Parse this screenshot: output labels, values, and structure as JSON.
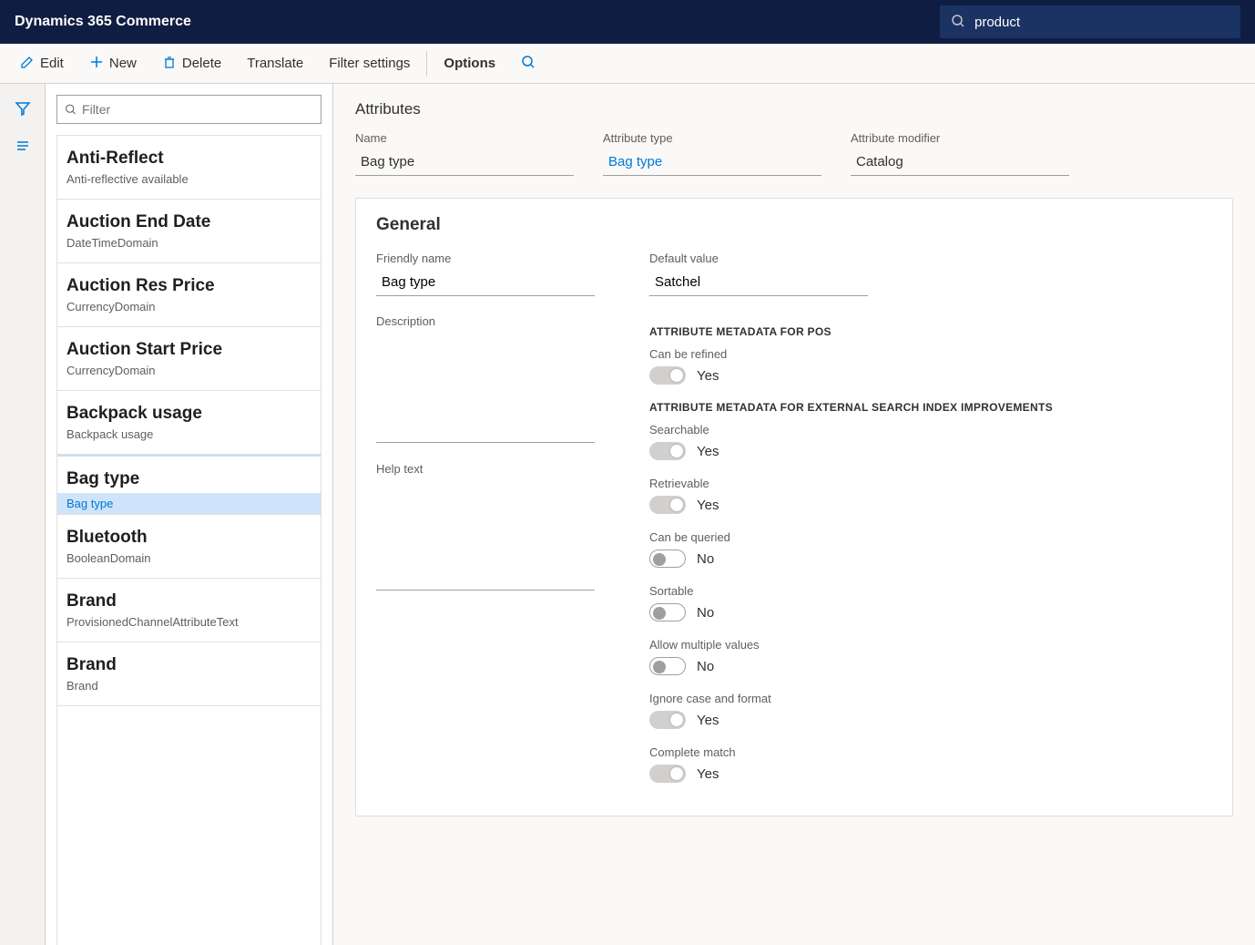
{
  "header": {
    "app_title": "Dynamics 365 Commerce",
    "search_value": "product"
  },
  "command_bar": {
    "edit": "Edit",
    "new": "New",
    "delete": "Delete",
    "translate": "Translate",
    "filter_settings": "Filter settings",
    "options": "Options"
  },
  "list": {
    "filter_placeholder": "Filter",
    "items": [
      {
        "title": "Anti-Reflect",
        "sub": "Anti-reflective available",
        "selected": false
      },
      {
        "title": "Auction End Date",
        "sub": "DateTimeDomain",
        "selected": false
      },
      {
        "title": "Auction Res Price",
        "sub": "CurrencyDomain",
        "selected": false
      },
      {
        "title": "Auction Start Price",
        "sub": "CurrencyDomain",
        "selected": false
      },
      {
        "title": "Backpack usage",
        "sub": "Backpack usage",
        "selected": false
      },
      {
        "title": "Bag type",
        "sub": "Bag type",
        "selected": true
      },
      {
        "title": "Bluetooth",
        "sub": "BooleanDomain",
        "selected": false
      },
      {
        "title": "Brand",
        "sub": "ProvisionedChannelAttributeText",
        "selected": false
      },
      {
        "title": "Brand",
        "sub": "Brand",
        "selected": false
      }
    ]
  },
  "detail": {
    "heading": "Attributes",
    "name_label": "Name",
    "name_value": "Bag type",
    "attr_type_label": "Attribute type",
    "attr_type_value": "Bag type",
    "attr_modifier_label": "Attribute modifier",
    "attr_modifier_value": "Catalog",
    "general_title": "General",
    "friendly_name_label": "Friendly name",
    "friendly_name_value": "Bag type",
    "description_label": "Description",
    "help_text_label": "Help text",
    "default_value_label": "Default value",
    "default_value_value": "Satchel",
    "section_pos": "ATTRIBUTE METADATA FOR POS",
    "section_search": "ATTRIBUTE METADATA FOR EXTERNAL SEARCH INDEX IMPROVEMENTS",
    "toggles": {
      "can_be_refined": {
        "label": "Can be refined",
        "on": true,
        "text": "Yes"
      },
      "searchable": {
        "label": "Searchable",
        "on": true,
        "text": "Yes"
      },
      "retrievable": {
        "label": "Retrievable",
        "on": true,
        "text": "Yes"
      },
      "can_be_queried": {
        "label": "Can be queried",
        "on": false,
        "text": "No"
      },
      "sortable": {
        "label": "Sortable",
        "on": false,
        "text": "No"
      },
      "allow_multiple": {
        "label": "Allow multiple values",
        "on": false,
        "text": "No"
      },
      "ignore_case": {
        "label": "Ignore case and format",
        "on": true,
        "text": "Yes"
      },
      "complete_match": {
        "label": "Complete match",
        "on": true,
        "text": "Yes"
      }
    }
  }
}
